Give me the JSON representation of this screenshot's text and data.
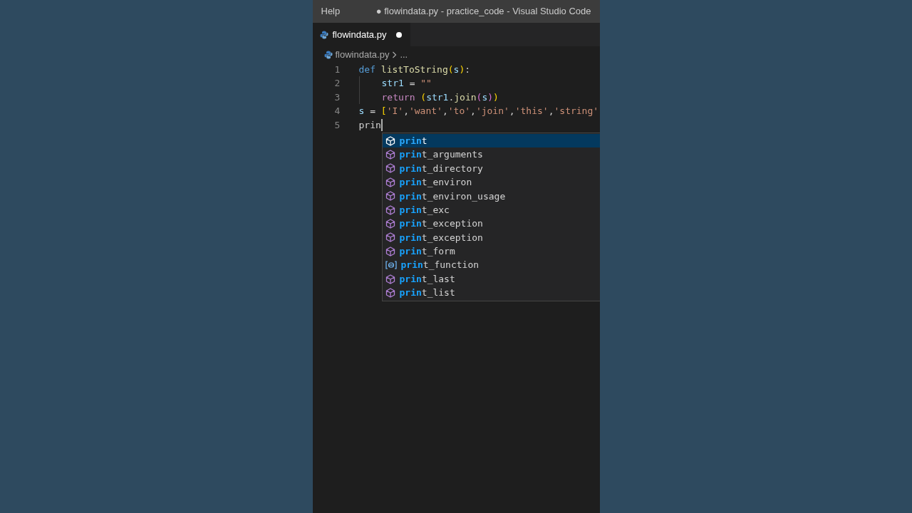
{
  "title_bar": {
    "menu": "Help",
    "title": "● flowindata.py - practice_code - Visual Studio Code"
  },
  "tabs": [
    {
      "label": "flowindata.py",
      "selected": true,
      "dirty": true
    }
  ],
  "breadcrumb": [
    "flowindata.py",
    "..."
  ],
  "code_lines": [
    {
      "number": "1",
      "indent": false,
      "tokens": [
        {
          "text": "def ",
          "kind": "keyword"
        },
        {
          "text": "listToString",
          "kind": "function"
        },
        {
          "text": "(",
          "kind": "bracket1"
        },
        {
          "text": "s",
          "kind": "variable"
        },
        {
          "text": ")",
          "kind": "bracket1"
        },
        {
          "text": ":",
          "kind": "plain"
        }
      ]
    },
    {
      "number": "2",
      "indent": true,
      "tokens": [
        {
          "text": "str1",
          "kind": "variable"
        },
        {
          "text": " = ",
          "kind": "plain"
        },
        {
          "text": "\"\"",
          "kind": "string"
        }
      ]
    },
    {
      "number": "3",
      "indent": true,
      "tokens": [
        {
          "text": "return ",
          "kind": "control"
        },
        {
          "text": "(",
          "kind": "bracket1"
        },
        {
          "text": "str1",
          "kind": "variable"
        },
        {
          "text": ".",
          "kind": "plain"
        },
        {
          "text": "join",
          "kind": "function"
        },
        {
          "text": "(",
          "kind": "bracket2"
        },
        {
          "text": "s",
          "kind": "variable"
        },
        {
          "text": ")",
          "kind": "bracket2"
        },
        {
          "text": ")",
          "kind": "bracket1"
        }
      ]
    },
    {
      "number": "4",
      "indent": false,
      "tokens": [
        {
          "text": "s",
          "kind": "variable"
        },
        {
          "text": " = ",
          "kind": "plain"
        },
        {
          "text": "[",
          "kind": "bracket1"
        },
        {
          "text": "'I'",
          "kind": "string"
        },
        {
          "text": ",",
          "kind": "plain"
        },
        {
          "text": "'want'",
          "kind": "string"
        },
        {
          "text": ",",
          "kind": "plain"
        },
        {
          "text": "'to'",
          "kind": "string"
        },
        {
          "text": ",",
          "kind": "plain"
        },
        {
          "text": "'join'",
          "kind": "string"
        },
        {
          "text": ",",
          "kind": "plain"
        },
        {
          "text": "'this'",
          "kind": "string"
        },
        {
          "text": ",",
          "kind": "plain"
        },
        {
          "text": "'string'",
          "kind": "string"
        }
      ]
    },
    {
      "number": "5",
      "indent": false,
      "cursor": true,
      "tokens": [
        {
          "text": "prin",
          "kind": "plain"
        }
      ]
    }
  ],
  "suggestions": [
    {
      "match": "prin",
      "rest": "t",
      "kind": "module",
      "selected": true
    },
    {
      "match": "prin",
      "rest": "t_arguments",
      "kind": "module",
      "selected": false
    },
    {
      "match": "prin",
      "rest": "t_directory",
      "kind": "module",
      "selected": false
    },
    {
      "match": "prin",
      "rest": "t_environ",
      "kind": "module",
      "selected": false
    },
    {
      "match": "prin",
      "rest": "t_environ_usage",
      "kind": "module",
      "selected": false
    },
    {
      "match": "prin",
      "rest": "t_exc",
      "kind": "module",
      "selected": false
    },
    {
      "match": "prin",
      "rest": "t_exception",
      "kind": "module",
      "selected": false
    },
    {
      "match": "prin",
      "rest": "t_exception",
      "kind": "module",
      "selected": false
    },
    {
      "match": "prin",
      "rest": "t_form",
      "kind": "module",
      "selected": false
    },
    {
      "match": "prin",
      "rest": "t_function",
      "kind": "variable",
      "selected": false
    },
    {
      "match": "prin",
      "rest": "t_last",
      "kind": "module",
      "selected": false
    },
    {
      "match": "prin",
      "rest": "t_list",
      "kind": "module",
      "selected": false
    }
  ]
}
